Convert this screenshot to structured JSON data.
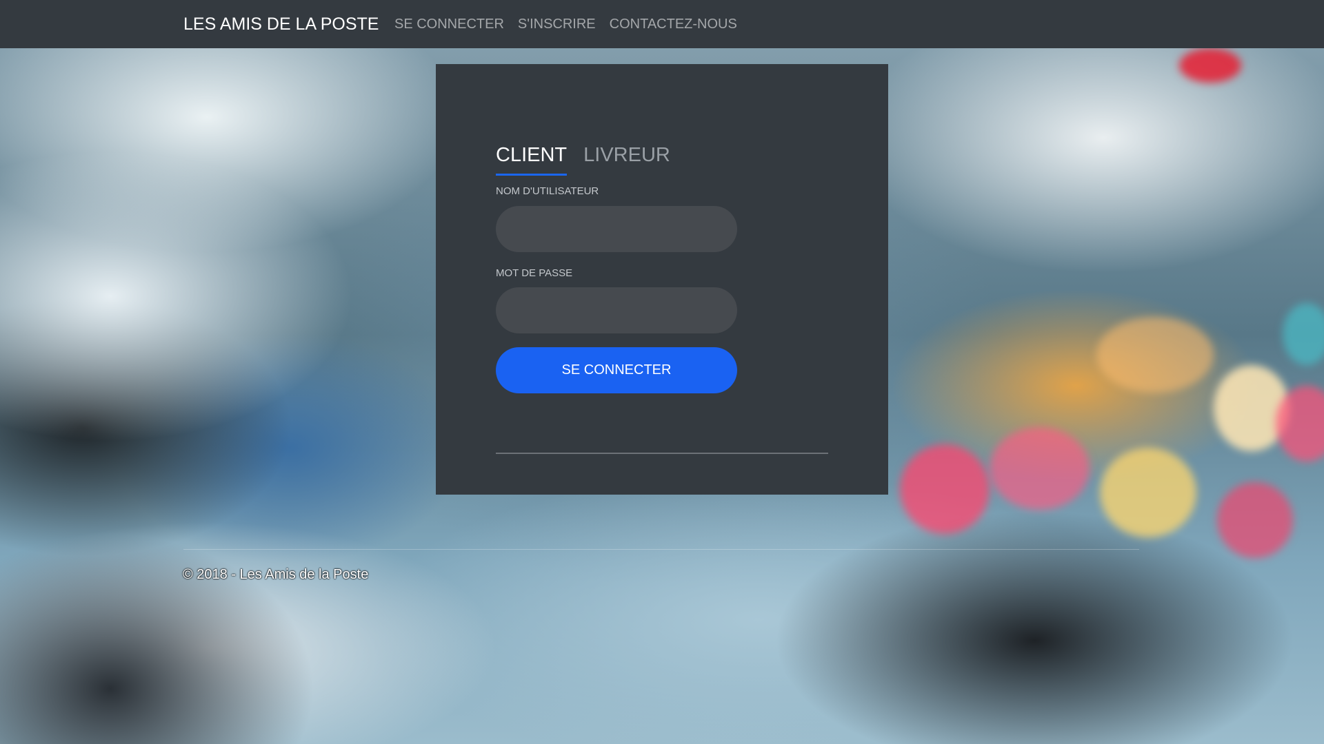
{
  "navbar": {
    "brand": "LES AMIS DE LA POSTE",
    "links": [
      {
        "label": "SE CONNECTER"
      },
      {
        "label": "S'INSCRIRE"
      },
      {
        "label": "CONTACTEZ-NOUS"
      }
    ]
  },
  "login": {
    "tabs": [
      {
        "label": "CLIENT",
        "active": true
      },
      {
        "label": "LIVREUR",
        "active": false
      }
    ],
    "username": {
      "label": "NOM D'UTILISATEUR",
      "value": ""
    },
    "password": {
      "label": "MOT DE PASSE",
      "value": ""
    },
    "submit_label": "SE CONNECTER"
  },
  "footer": {
    "copyright": "© 2018 - Les Amis de la Poste"
  },
  "colors": {
    "navbar_bg": "#343a40",
    "card_bg": "#343a40",
    "accent": "#1a62f2",
    "input_bg": "#464a4f"
  }
}
